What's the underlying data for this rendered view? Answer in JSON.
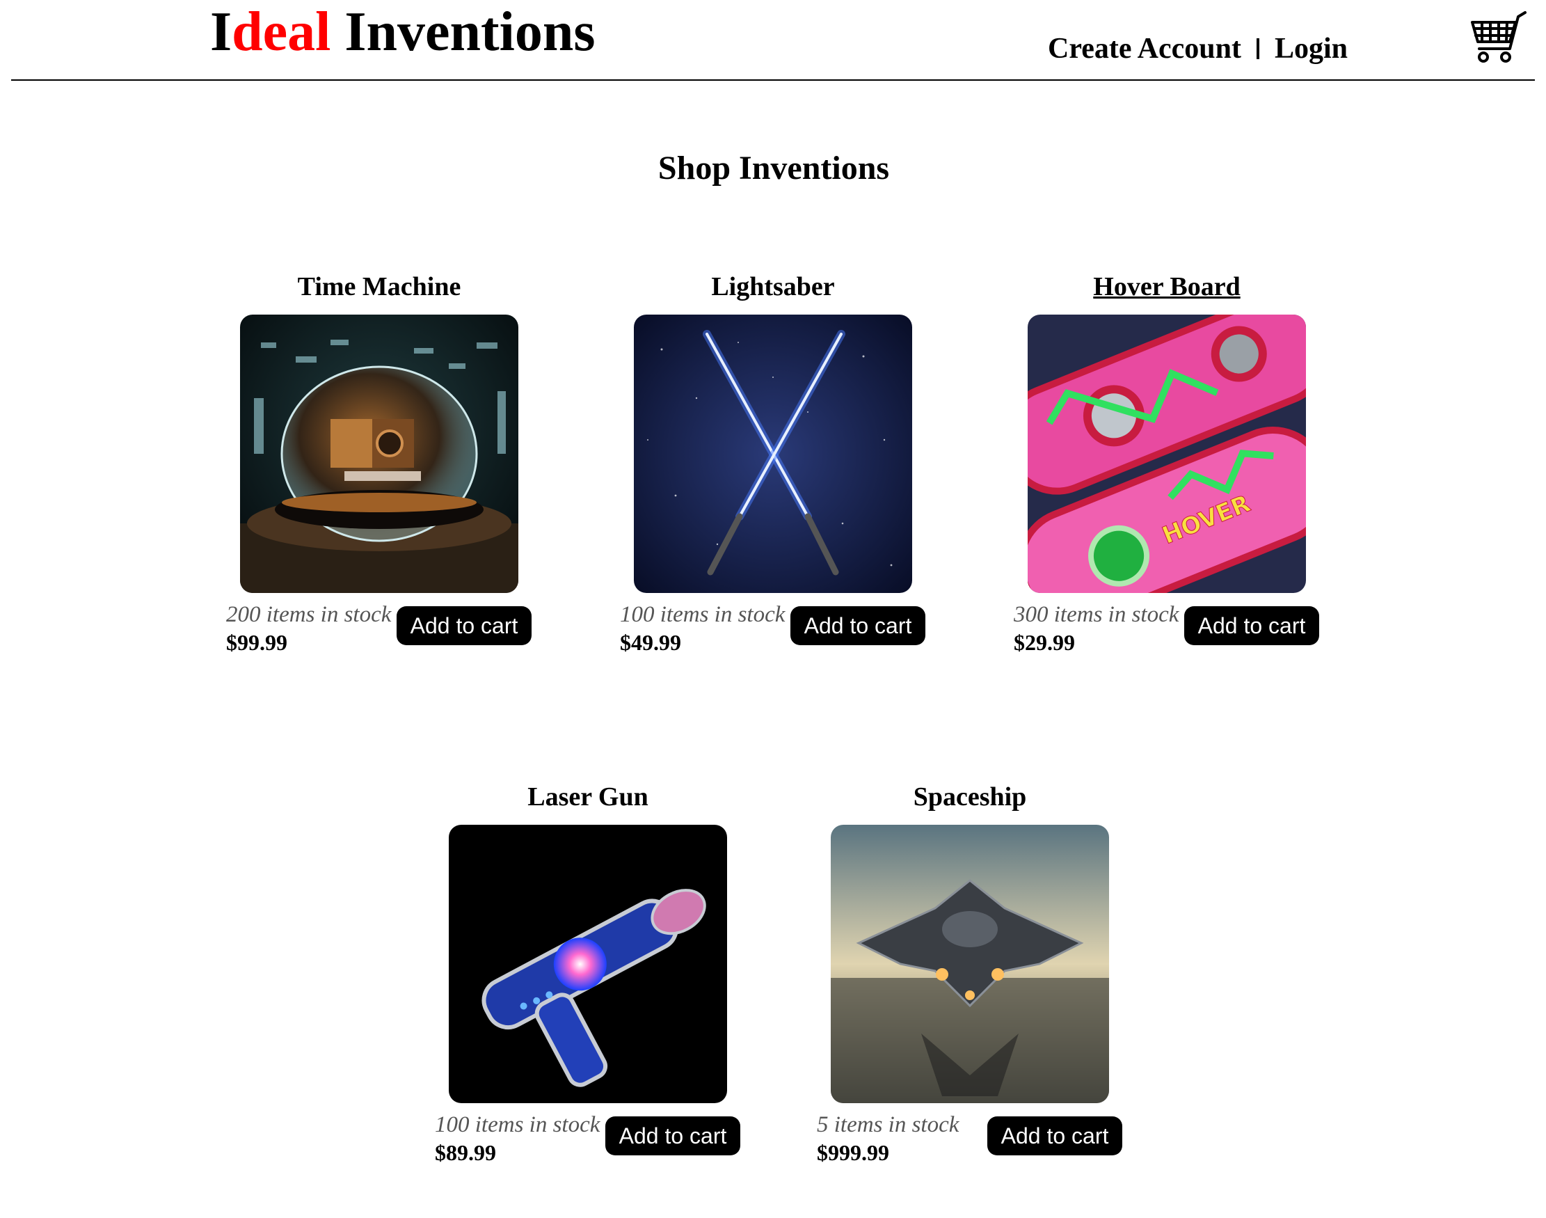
{
  "header": {
    "logo_first": "I",
    "logo_red": "deal",
    "logo_rest": " Inventions",
    "create_account": "Create Account",
    "login": "Login",
    "cart_icon": "shopping-cart-icon"
  },
  "page_title": "Shop Inventions",
  "colors": {
    "logo_accent": "#ff0000",
    "button_bg": "#000000",
    "button_text": "#ffffff",
    "stock_text": "#555555"
  },
  "products": [
    {
      "name": "Time Machine",
      "stock": "200 items in stock",
      "price": "$99.99",
      "button": "Add to cart"
    },
    {
      "name": "Lightsaber",
      "stock": "100 items in stock",
      "price": "$49.99",
      "button": "Add to cart"
    },
    {
      "name": "Hover Board",
      "stock": "300 items in stock",
      "price": "$29.99",
      "button": "Add to cart"
    },
    {
      "name": "Laser Gun",
      "stock": "100 items in stock",
      "price": "$89.99",
      "button": "Add to cart"
    },
    {
      "name": "Spaceship",
      "stock": "5 items in stock",
      "price": "$999.99",
      "button": "Add to cart"
    }
  ]
}
